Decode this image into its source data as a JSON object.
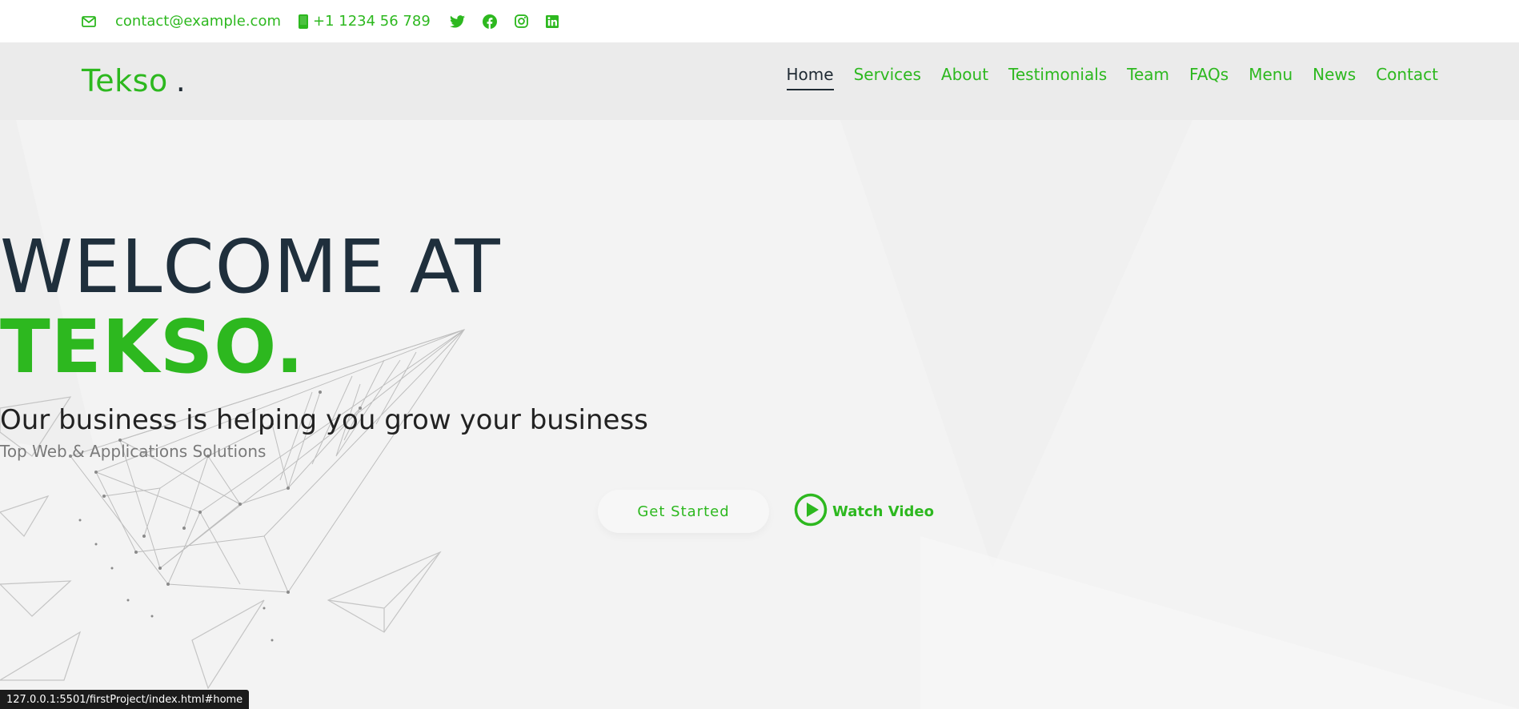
{
  "topbar": {
    "email": "contact@example.com",
    "phone": "+1 1234 56 789",
    "icons": [
      "envelope-icon",
      "phone-icon",
      "twitter-icon",
      "facebook-icon",
      "instagram-icon",
      "linkedin-icon"
    ]
  },
  "header": {
    "logo_text": "Tekso",
    "logo_dot": ".",
    "nav": [
      {
        "label": "Home",
        "active": true
      },
      {
        "label": "Services"
      },
      {
        "label": "About"
      },
      {
        "label": "Testimonials"
      },
      {
        "label": "Team"
      },
      {
        "label": "FAQs"
      },
      {
        "label": "Menu"
      },
      {
        "label": "News"
      },
      {
        "label": "Contact"
      }
    ]
  },
  "hero": {
    "line1": "WELCOME AT",
    "line2": "TEKSO.",
    "tagline": "Our business is helping you grow your business",
    "subtag": "Top Web & Applications Solutions",
    "cta_primary": "Get Started",
    "cta_secondary": "Watch Video"
  },
  "status_url": "127.0.0.1:5501/firstProject/index.html#home",
  "colors": {
    "accent": "#2db81f",
    "dark": "#1f2f3c",
    "header_bg": "#ebebeb",
    "hero_bg": "#f3f3f3"
  }
}
